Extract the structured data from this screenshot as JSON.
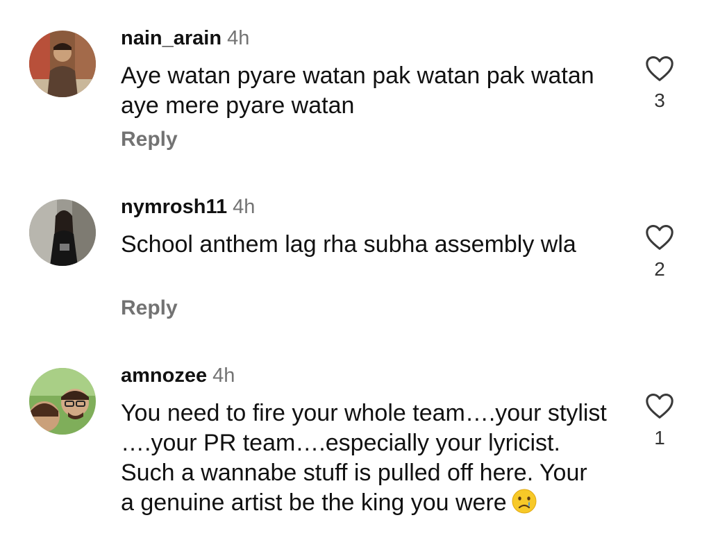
{
  "comments": [
    {
      "username": "nain_arain",
      "time": "4h",
      "text": "Aye watan pyare watan pak watan pak watan aye mere pyare watan",
      "reply_label": "Reply",
      "likes": "3"
    },
    {
      "username": "nymrosh11",
      "time": "4h",
      "text": "School anthem  lag rha  subha assembly wla",
      "reply_label": "Reply",
      "likes": "2"
    },
    {
      "username": "amnozee",
      "time": "4h",
      "text": "You need to fire your whole team….your stylist ….your PR team….especially your lyricist. Such a wannabe stuff is pulled off here. Your a genuine artist be the king you were",
      "likes": "1",
      "emoji": "crying-face"
    }
  ],
  "icons": {
    "like": "heart-outline-icon"
  }
}
